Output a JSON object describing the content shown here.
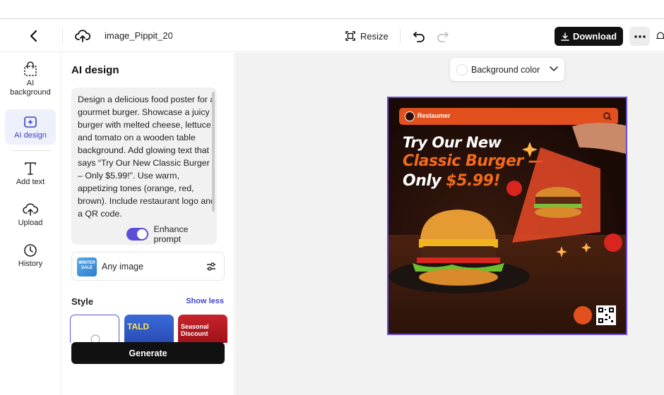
{
  "topbar": {
    "project_name": "image_Pippit_20",
    "resize_label": "Resize",
    "download_label": "Download"
  },
  "rail": {
    "items": [
      {
        "label": "AI background",
        "icon": "bag-icon"
      },
      {
        "label": "AI design",
        "icon": "sparkle-image-icon"
      },
      {
        "label": "Add text",
        "icon": "text-icon"
      },
      {
        "label": "Upload",
        "icon": "cloud-upload-icon"
      },
      {
        "label": "History",
        "icon": "clock-icon"
      }
    ]
  },
  "panel": {
    "title": "AI design",
    "prompt": "Design a delicious food poster for a gourmet burger. Showcase a juicy burger with melted cheese, lettuce, and tomato on a wooden table background. Add glowing text that says “Try Our New Classic Burger – Only $5.99!”. Use warm, appetizing tones (orange, red, brown). Include restaurant logo and a QR code.",
    "enhance_label": "Enhance prompt",
    "enhance_on": true,
    "image_type_label": "Any image",
    "image_type_thumb_text": "WINTER SALE",
    "style_label": "Style",
    "show_less_label": "Show less",
    "style_thumbs": [
      "TALD",
      "Seasonal Discount"
    ],
    "generate_label": "Generate"
  },
  "canvas": {
    "bg_color_label": "Background color",
    "poster": {
      "brand": "Restaumer",
      "line1": "Try Our New",
      "line2": "Classic Burger —",
      "line3_prefix": "Only ",
      "line3_price": "$5.99!"
    }
  },
  "colors": {
    "accent": "#5b4fd8",
    "poster_orange": "#f36a1c",
    "selection_border": "#6a4bd6"
  }
}
